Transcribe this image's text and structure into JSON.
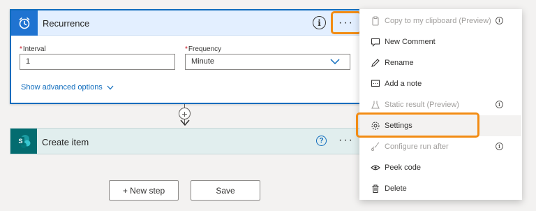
{
  "recurrence": {
    "title": "Recurrence",
    "more_label": "···",
    "interval": {
      "label": "Interval",
      "value": "1"
    },
    "frequency": {
      "label": "Frequency",
      "value": "Minute"
    },
    "advanced_link": "Show advanced options"
  },
  "create_item": {
    "title": "Create item",
    "help_label": "?",
    "more_label": "···",
    "icon_letter": "S"
  },
  "buttons": {
    "new_step": "+ New step",
    "save": "Save"
  },
  "menu": {
    "items": [
      {
        "label": "Copy to my clipboard (Preview)",
        "icon": "clipboard-icon",
        "disabled": true,
        "info": true
      },
      {
        "label": "New Comment",
        "icon": "comment-icon",
        "disabled": false,
        "info": false
      },
      {
        "label": "Rename",
        "icon": "pencil-icon",
        "disabled": false,
        "info": false
      },
      {
        "label": "Add a note",
        "icon": "note-icon",
        "disabled": false,
        "info": false
      },
      {
        "label": "Static result (Preview)",
        "icon": "flask-icon",
        "disabled": true,
        "info": true
      },
      {
        "label": "Settings",
        "icon": "gear-icon",
        "disabled": false,
        "info": false
      },
      {
        "label": "Configure run after",
        "icon": "link-icon",
        "disabled": true,
        "info": true
      },
      {
        "label": "Peek code",
        "icon": "eye-icon",
        "disabled": false,
        "info": false
      },
      {
        "label": "Delete",
        "icon": "trash-icon",
        "disabled": false,
        "info": false
      }
    ]
  },
  "colors": {
    "accent": "#0f6cbd",
    "highlight": "#f28c14",
    "sharepoint": "#036c70"
  }
}
